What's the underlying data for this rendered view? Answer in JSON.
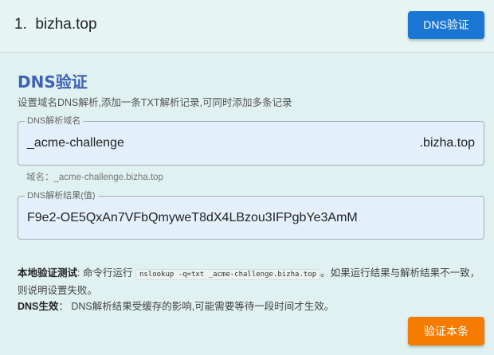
{
  "header": {
    "index": "1.",
    "domain": "bizha.top",
    "dns_button": "DNS验证"
  },
  "section": {
    "title": "DNS验证",
    "description": "设置域名DNS解析,添加一条TXT解析记录,可同时添加多条记录"
  },
  "record_name_field": {
    "legend": "DNS解析域名",
    "value": "_acme-challenge",
    "suffix": ".bizha.top",
    "hint": "域名：_acme-challenge.bizha.top"
  },
  "record_value_field": {
    "legend": "DNS解析结果(值)",
    "value": "F9e2-OE5QxAn7VFbQmywеT8dX4LBzou3IFPgbYe3AmM"
  },
  "local_test": {
    "label": "本地验证测试",
    "text_before": ": 命令行运行",
    "command": "nslookup -q=txt _acme-challenge.bizha.top",
    "text_after": "。如果运行结果与解析结果不一致，则说明设置失败。"
  },
  "dns_effect": {
    "label": "DNS生效",
    "text": "： DNS解析结果受缓存的影响,可能需要等待一段时间才生效。"
  },
  "verify_button": "验证本条"
}
